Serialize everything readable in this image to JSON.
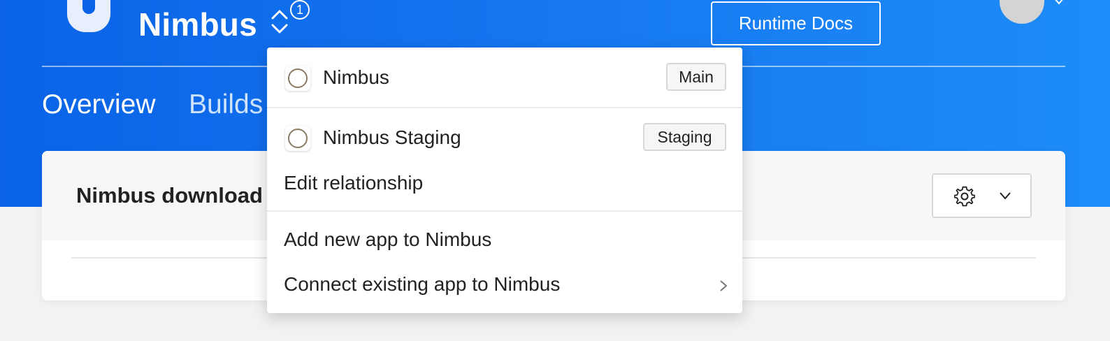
{
  "header": {
    "app_name": "Nimbus",
    "notification_count": "1",
    "docs_button_label": "Runtime Docs"
  },
  "tabs": [
    {
      "label": "Overview"
    },
    {
      "label": "Builds"
    }
  ],
  "card": {
    "title": "Nimbus download"
  },
  "dropdown": {
    "apps": [
      {
        "name": "Nimbus",
        "tag": "Main"
      },
      {
        "name": "Nimbus Staging",
        "tag": "Staging"
      }
    ],
    "edit_relationship": "Edit relationship",
    "add_new_app": "Add new app to Nimbus",
    "connect_existing_app": "Connect existing app to Nimbus"
  },
  "colors": {
    "header_blue": "#0a63e6",
    "header_blue_light": "#1d8cf8",
    "white": "#ffffff"
  },
  "icons": [
    "app-logo-icon",
    "switcher-chevrons-icon",
    "avatar",
    "chevron-down-icon",
    "gear-icon",
    "chevron-right-icon",
    "radio-icon"
  ]
}
